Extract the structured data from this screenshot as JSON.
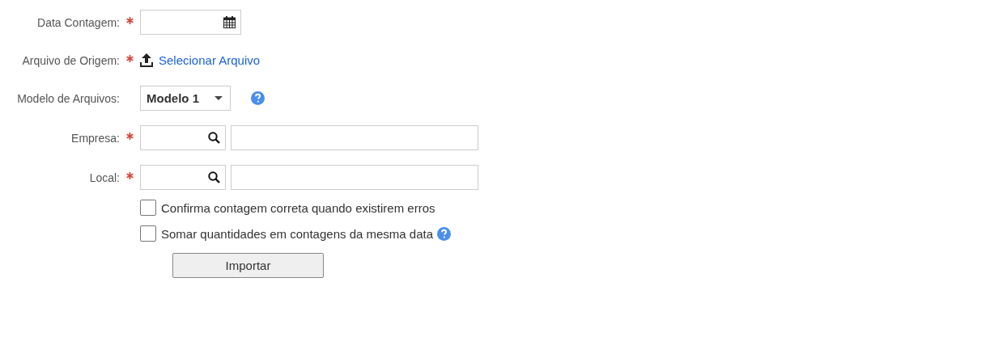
{
  "fields": [
    {
      "kind": "date",
      "label": "Data Contagem:",
      "required": true
    },
    {
      "kind": "file",
      "label": "Arquivo de Origem:",
      "required": true,
      "link": "Selecionar Arquivo"
    },
    {
      "kind": "select",
      "label": "Modelo de Arquivos:",
      "required": false,
      "value": "Modelo 1",
      "help": true
    },
    {
      "kind": "lookup",
      "label": "Empresa:",
      "required": true
    },
    {
      "kind": "lookup",
      "label": "Local:",
      "required": true
    }
  ],
  "options": [
    {
      "label": "Confirma contagem correta quando existirem erros",
      "checked": false,
      "help": false
    },
    {
      "label": "Somar quantidades em contagens da mesma data",
      "checked": false,
      "help": true
    }
  ],
  "button": "Importar"
}
